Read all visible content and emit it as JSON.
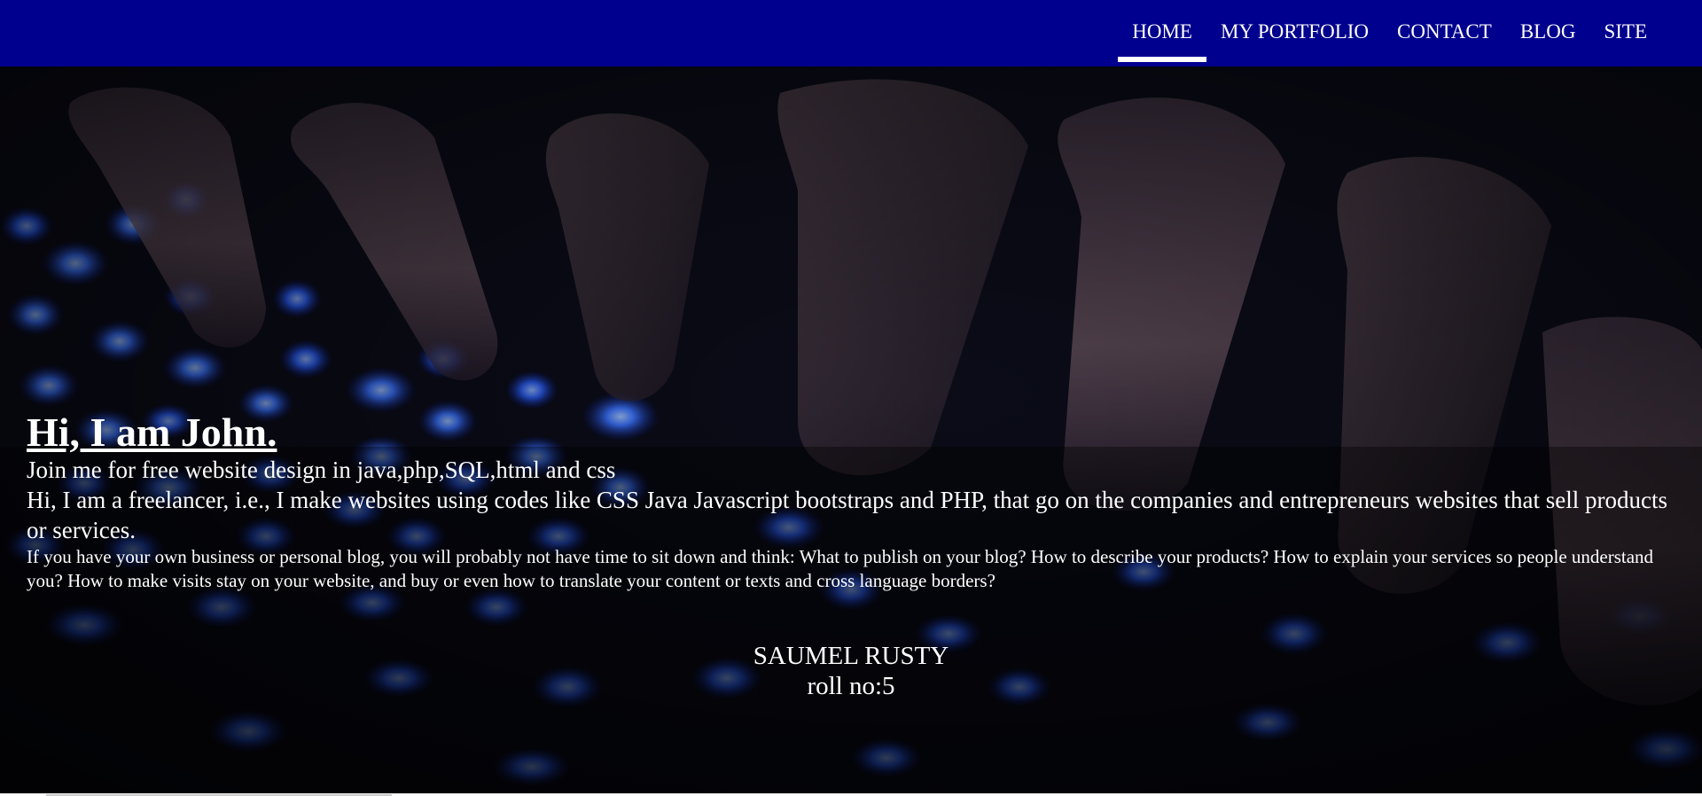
{
  "nav": {
    "items": [
      {
        "label": "HOME",
        "active": true
      },
      {
        "label": "MY PORTFOLIO",
        "active": false
      },
      {
        "label": "CONTACT",
        "active": false
      },
      {
        "label": "BLOG",
        "active": false
      },
      {
        "label": "SITE",
        "active": false
      }
    ],
    "background": "#00008f"
  },
  "hero": {
    "title": "Hi, I am John.",
    "tagline": "Join me for free website design in java,php,SQL,html and css",
    "intro": "Hi, I am a freelancer, i.e., I make websites using codes like CSS Java Javascript bootstraps and PHP, that go on the companies and entrepreneurs websites that sell products or services.",
    "details": "If you have your own business or personal blog, you will probably not have time to sit down and think: What to publish on your blog? How to describe your products? How to explain your services so people understand you? How to make visits stay on your website, and buy or even how to translate your content or texts and cross language borders?",
    "background_image": "keyboard-typing-photo"
  },
  "signature": {
    "name": "SAUMEL RUSTY",
    "roll": "roll no:5"
  },
  "colors": {
    "accent": "#00008f",
    "key_glow": "#2f6bff",
    "text": "#ffffff"
  }
}
